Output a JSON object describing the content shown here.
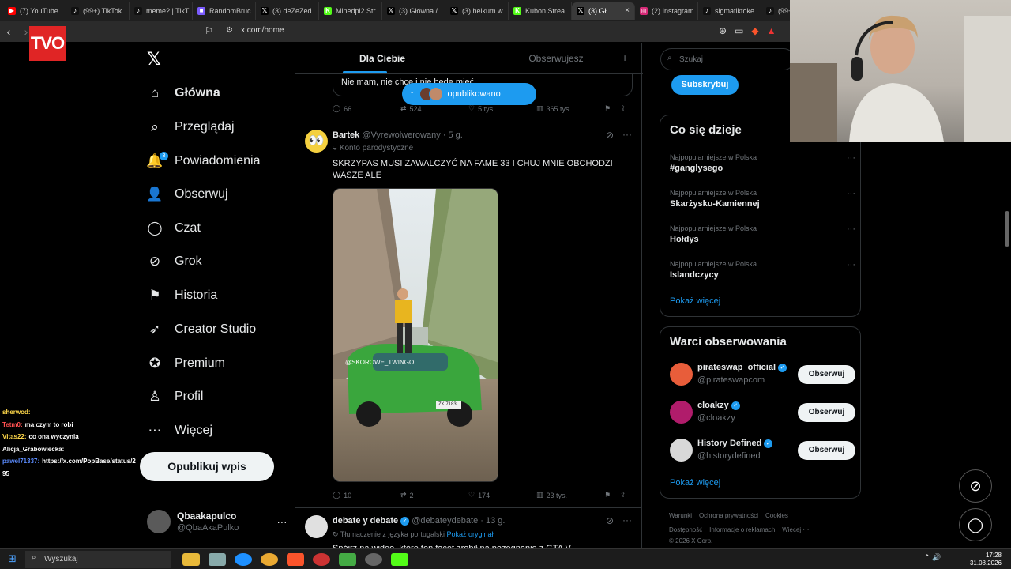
{
  "browser": {
    "tabs": [
      {
        "label": "(7) YouTube",
        "fav_color": "#ff0000",
        "fav": "▶"
      },
      {
        "label": "(99+) TikTok",
        "fav_color": "#111111",
        "fav": "♪"
      },
      {
        "label": "meme? | TikT",
        "fav_color": "#111111",
        "fav": "♪"
      },
      {
        "label": "RandomBruc",
        "fav_color": "#7b5cff",
        "fav": "■"
      },
      {
        "label": "(3) deZeZed",
        "fav_color": "#000000",
        "fav": "𝕏"
      },
      {
        "label": "Minedpl2 Str",
        "fav_color": "#53fc18",
        "fav": "K"
      },
      {
        "label": "(3) Główna /",
        "fav_color": "#000000",
        "fav": "𝕏"
      },
      {
        "label": "(3) helkum w",
        "fav_color": "#000000",
        "fav": "𝕏"
      },
      {
        "label": "Kubon Strea",
        "fav_color": "#53fc18",
        "fav": "K"
      },
      {
        "label": "(3) Gł",
        "fav_color": "#000000",
        "fav": "𝕏"
      },
      {
        "label": "(2) Instagram",
        "fav_color": "#d62976",
        "fav": "◎"
      },
      {
        "label": "sigmatiktoke",
        "fav_color": "#111111",
        "fav": "♪"
      },
      {
        "label": "(99+",
        "fav_color": "#111111",
        "fav": "♪"
      }
    ],
    "url": "x.com/home"
  },
  "stream_logo": "TVO",
  "nav": {
    "items": [
      {
        "label": "Główna",
        "icon": "home-icon",
        "glyph": "⌂"
      },
      {
        "label": "Przeglądaj",
        "icon": "search-icon",
        "glyph": "⌕"
      },
      {
        "label": "Powiadomienia",
        "icon": "bell-icon",
        "glyph": "🔔",
        "badge": "3"
      },
      {
        "label": "Obserwuj",
        "icon": "follow-icon",
        "glyph": "👤"
      },
      {
        "label": "Czat",
        "icon": "chat-icon",
        "glyph": "◯"
      },
      {
        "label": "Grok",
        "icon": "grok-icon",
        "glyph": "⊘"
      },
      {
        "label": "Historia",
        "icon": "bookmark-icon",
        "glyph": "⚑"
      },
      {
        "label": "Creator Studio",
        "icon": "rocket-icon",
        "glyph": "➶"
      },
      {
        "label": "Premium",
        "icon": "premium-icon",
        "glyph": "✪"
      },
      {
        "label": "Profil",
        "icon": "profile-icon",
        "glyph": "♙"
      },
      {
        "label": "Więcej",
        "icon": "more-icon",
        "glyph": "⋯"
      }
    ],
    "post_button": "Opublikuj wpis",
    "account": {
      "name": "Qbaakapulco",
      "handle": "@QbaAkaPulko"
    }
  },
  "chat": [
    {
      "user": "sherwod:",
      "msg": "",
      "color": "#ffd84a"
    },
    {
      "user": "Tetm0:",
      "msg": "ma czym to robi",
      "color": "#ff5050"
    },
    {
      "user": "Vitas22:",
      "msg": "co ona  wyczynia",
      "color": "#ffd84a"
    },
    {
      "user": "Alicja_Grabowiecka:",
      "msg": "",
      "color": "#ffffff"
    },
    {
      "user": "pawel71337:",
      "msg": "https://x.com/PopBase/status/2",
      "color": "#5b8cff"
    },
    {
      "user": "95",
      "msg": "",
      "color": "#ffffff"
    }
  ],
  "feed": {
    "tabs": [
      "Dla Ciebie",
      "Obserwujesz"
    ],
    "plus": "+",
    "prev_post": {
      "quote_text": "Nie mam, nie chcę i nie będę mieć",
      "replies": "66",
      "reposts": "524",
      "likes": "5 tys.",
      "views": "365 tys."
    },
    "new_posts_pill": "opublikowano",
    "post": {
      "name": "Bartek",
      "handle": "@Vyrewolwerowany",
      "time": "· 5 g.",
      "label": "Konto parodystyczne",
      "text": "SKRZYPAS MUSI ZAWALCZYĆ NA FAME 33 I CHUJ MNIE OBCHODZI WASZE ALE",
      "watermark": "@SKOROWE_TWINGO",
      "plate": "ZK 7183",
      "replies": "10",
      "reposts": "2",
      "likes": "174",
      "views": "23 tys."
    },
    "next_post": {
      "name": "debate y debate",
      "handle": "@debateydebate",
      "time": "· 13 g.",
      "translated": "Tłumaczenie z języka portugalski",
      "show_original": "Pokaż oryginał",
      "text": "Spójrz na wideo, które ten facet zrobił na pożegnanie z GTA V"
    }
  },
  "right": {
    "search_placeholder": "Szukaj",
    "subscribe": "Subskrybuj",
    "trends_title": "Co się dzieje",
    "trends": [
      {
        "context": "Najpopularniejsze w Polska",
        "title": "#ganglysego"
      },
      {
        "context": "Najpopularniejsze w Polska",
        "title": "Skarżysku-Kamiennej"
      },
      {
        "context": "Najpopularniejsze w Polska",
        "title": "Hołdys"
      },
      {
        "context": "Najpopularniejsze w Polska",
        "title": "Islandczycy"
      }
    ],
    "show_more": "Pokaż więcej",
    "who_title": "Warci obserwowania",
    "who": [
      {
        "name": "pirateswap_official",
        "handle": "@pirateswapcom",
        "color": "#e85d3a"
      },
      {
        "name": "cloakzy",
        "handle": "@cloakzy",
        "color": "#b01c6b"
      },
      {
        "name": "History Defined",
        "handle": "@historydefined",
        "color": "#d8d8d8"
      }
    ],
    "follow": "Obserwuj",
    "footer_line1": [
      "Warunki",
      "Ochrona prywatności",
      "Cookies"
    ],
    "footer_line2": [
      "Dostępność",
      "Informacje o reklamach",
      "Więcej ···"
    ],
    "copyright": "© 2026 X Corp."
  },
  "taskbar": {
    "search": "Wyszukaj",
    "time": "17:28",
    "date": "31.08.2026"
  }
}
